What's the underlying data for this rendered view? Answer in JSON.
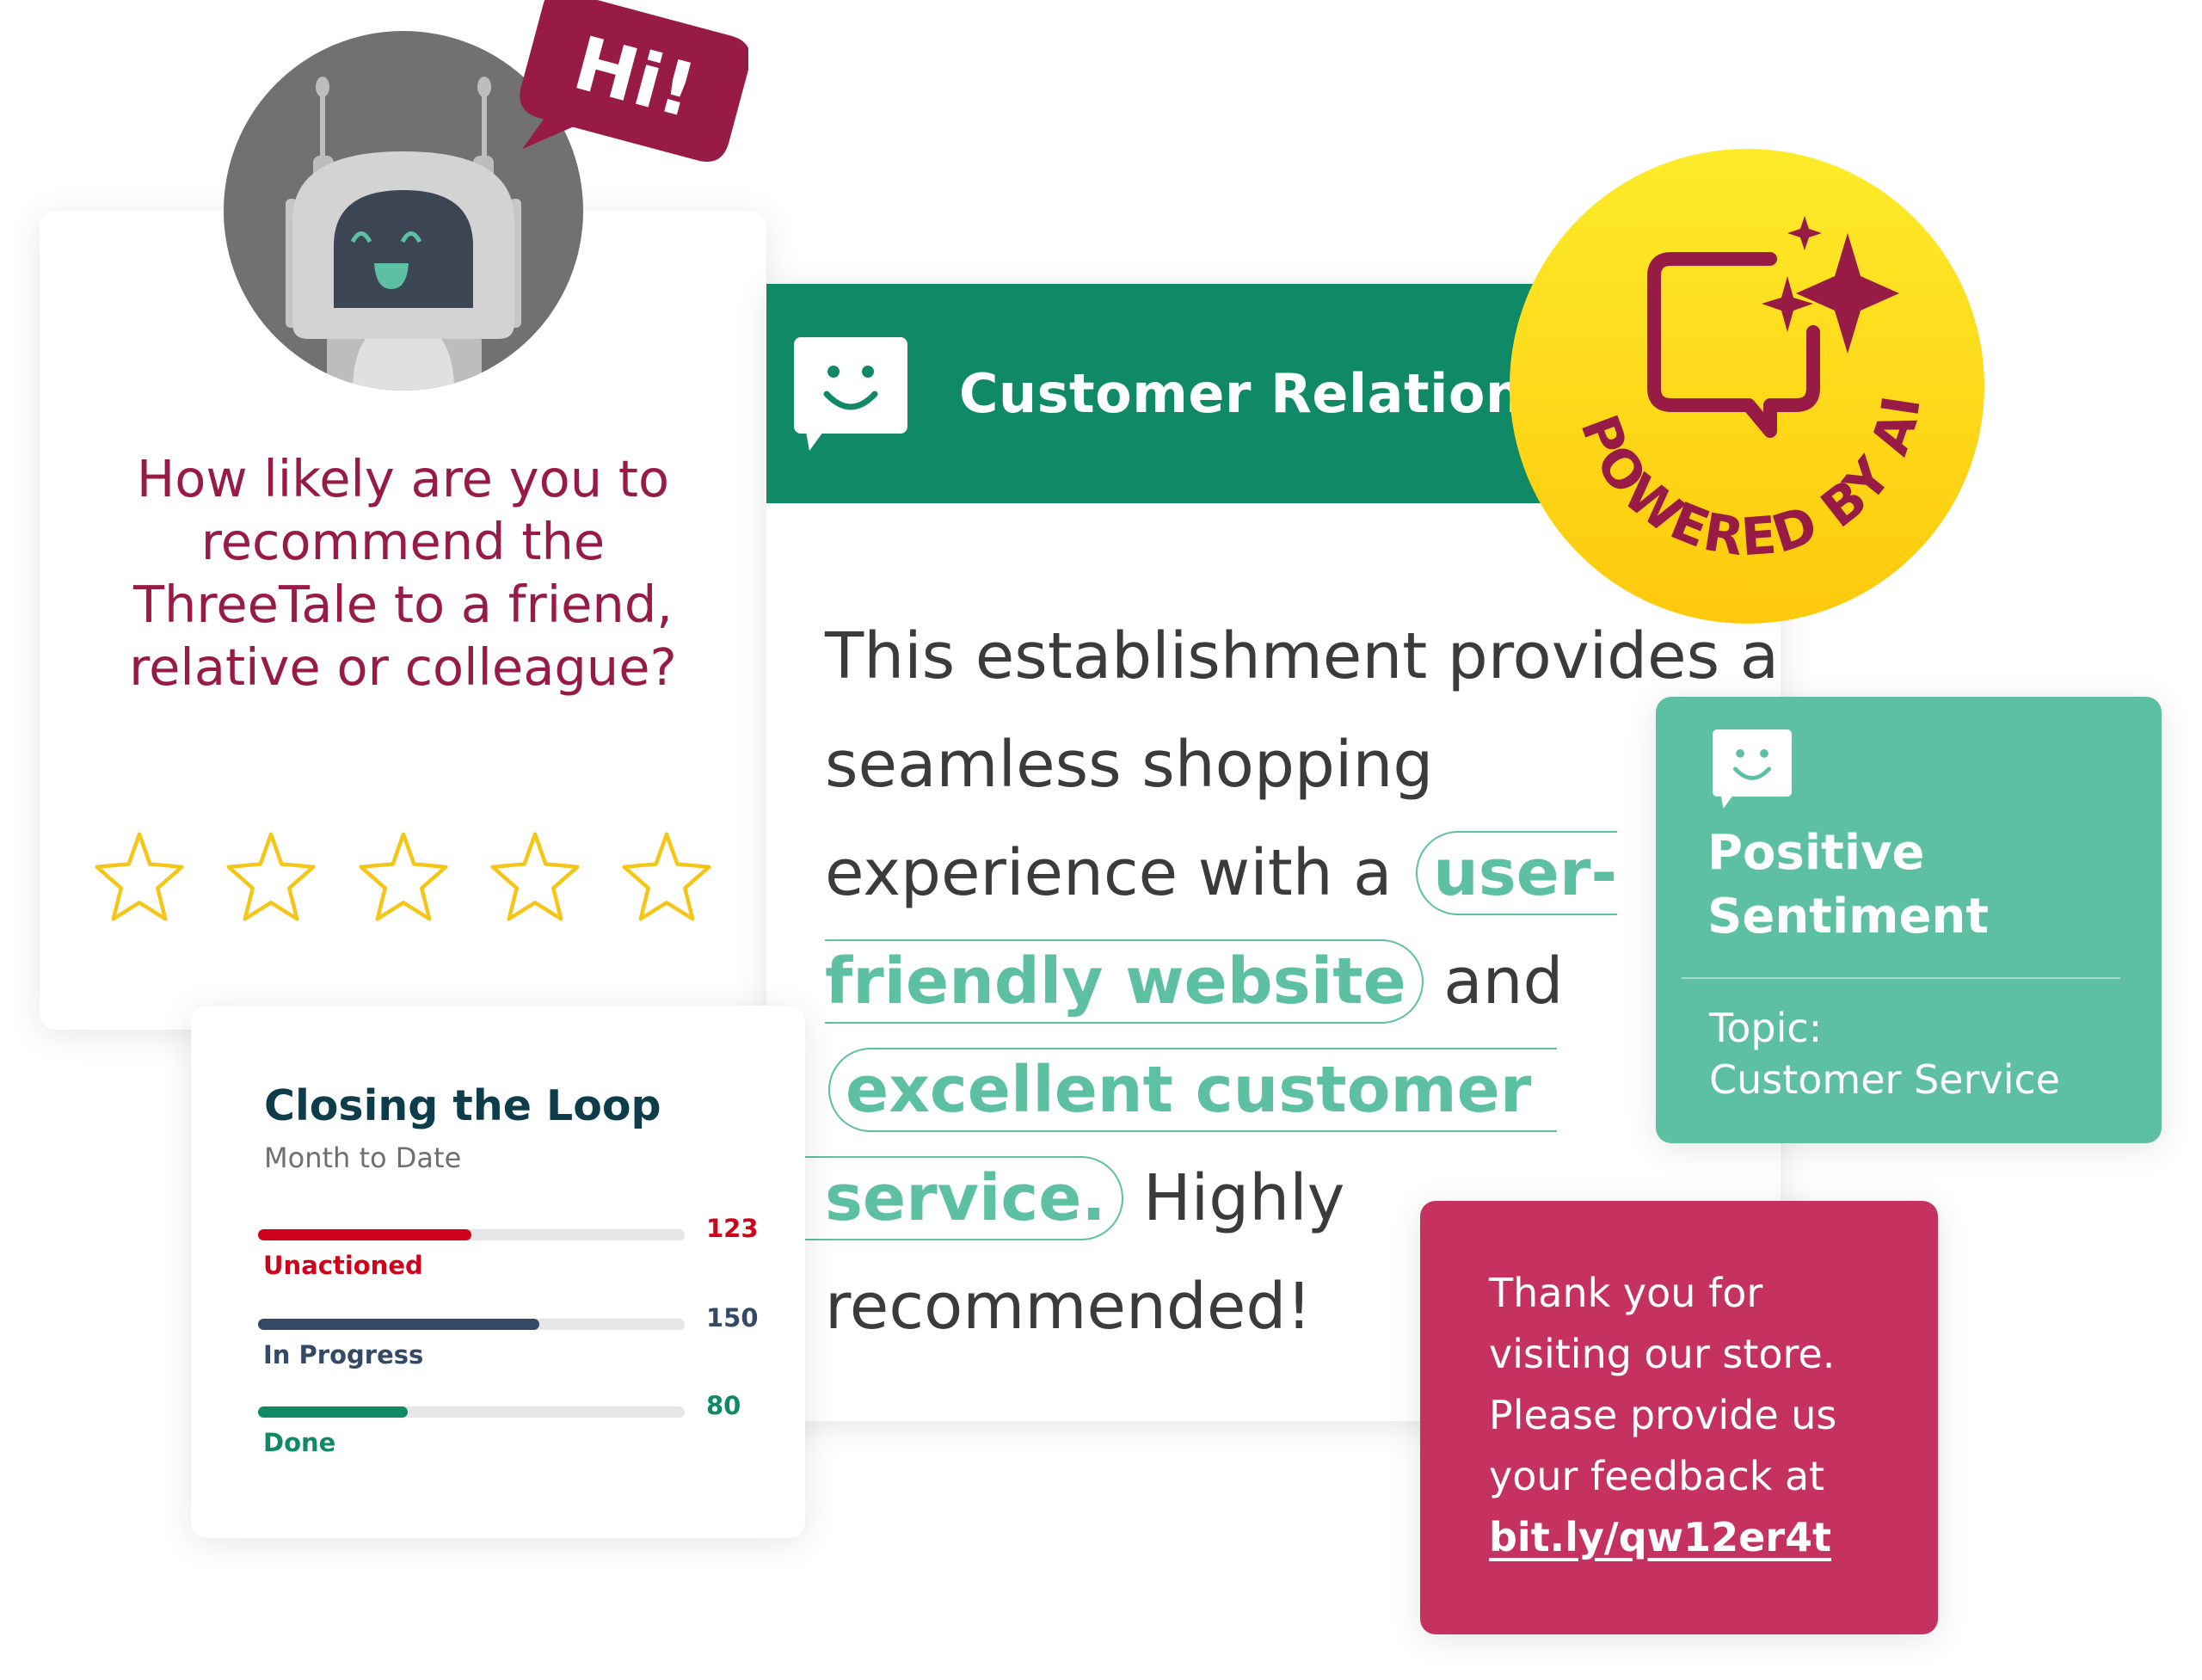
{
  "survey": {
    "greeting": "Hi!",
    "question": "How likely are you to recommend the ThreeTale to a friend, relative or colleague?",
    "rating": {
      "value": 0,
      "max": 5
    },
    "stars": [
      "star-1",
      "star-2",
      "star-3",
      "star-4",
      "star-5"
    ]
  },
  "review": {
    "header_title": "Customer Relations",
    "icon": "smiley-chat-icon",
    "body": {
      "part1": "This establishment provides a seamless shopping experience with a",
      "highlight1": "user-friendly website",
      "part2": "and",
      "highlight2a": "excellent customer",
      "highlight2b": "service.",
      "part3": "Highly recommended!"
    }
  },
  "badge": {
    "text": "POWERED BY AI",
    "icon": "sparkle-chat-icon"
  },
  "sentiment": {
    "title": "Positive Sentiment",
    "topic_label": "Topic:",
    "topic_value": "Customer Service",
    "icon": "smiley-chat-icon"
  },
  "closing_loop": {
    "title": "Closing the Loop",
    "subtitle": "Month to Date",
    "metrics": [
      {
        "label": "Unactioned",
        "value": "123",
        "fill": 0.5,
        "color": "#d0021b"
      },
      {
        "label": "In Progress",
        "value": "150",
        "fill": 0.66,
        "color": "#344966"
      },
      {
        "label": "Done",
        "value": "80",
        "fill": 0.35,
        "color": "#108a66"
      }
    ]
  },
  "feedback": {
    "text": "Thank you for visiting our store. Please provide us your feedback at",
    "link": "bit.ly/qw12er4t"
  },
  "colors": {
    "brand_green": "#108a66",
    "mint": "#5ec0a3",
    "crimson": "#981b45",
    "pink": "#c63260",
    "yellow": "#fde725",
    "star": "#f5c518"
  }
}
